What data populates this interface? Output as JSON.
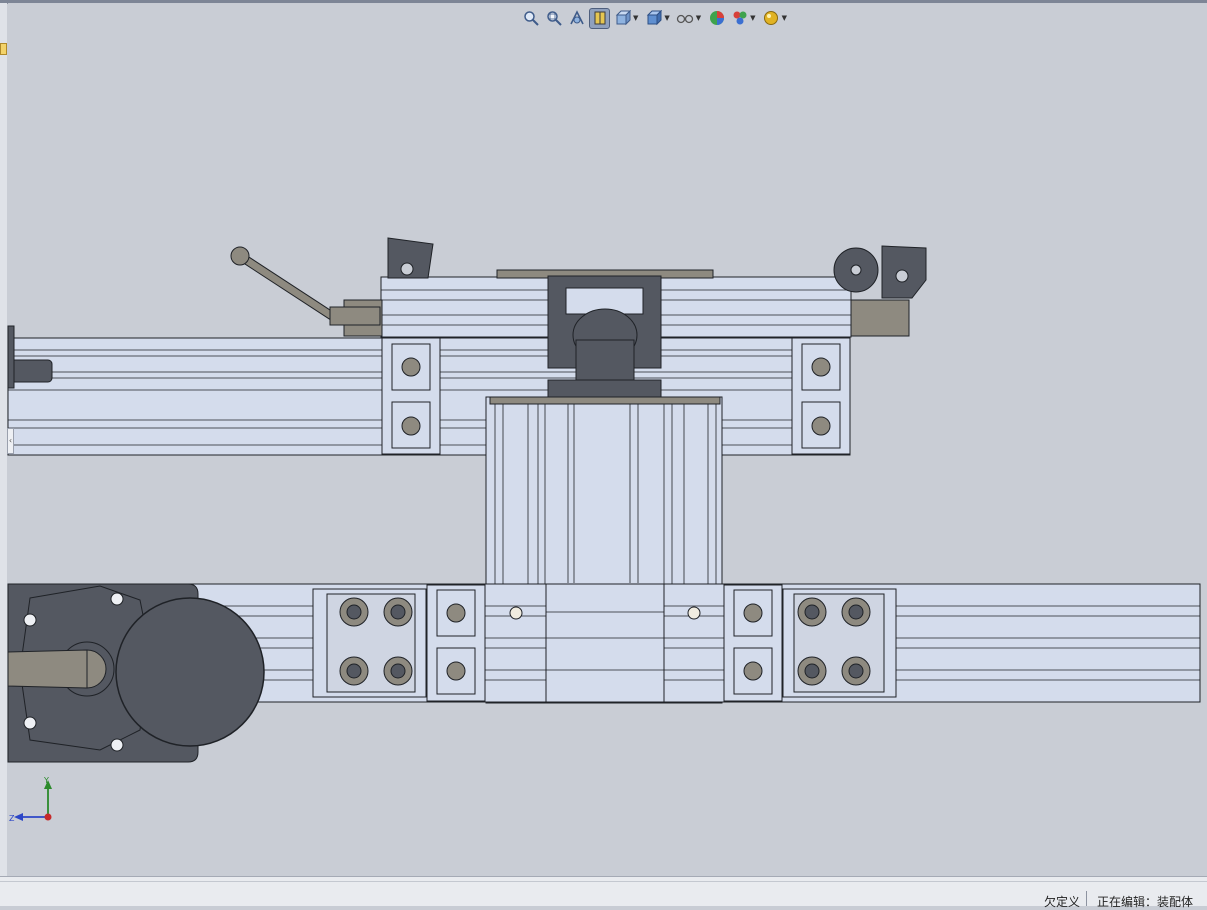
{
  "status_bar": {
    "constraint_status": "欠定义",
    "edit_mode": "正在编辑：装配体"
  },
  "triad": {
    "y_label": "Y",
    "z_label": "Z"
  },
  "heads_up_toolbar": {
    "tools": [
      {
        "name": "zoom-to-fit-icon"
      },
      {
        "name": "zoom-to-area-icon"
      },
      {
        "name": "previous-view-icon"
      },
      {
        "name": "section-view-icon",
        "active": true
      },
      {
        "name": "view-orientation-icon",
        "dropdown": true
      },
      {
        "name": "display-style-icon",
        "dropdown": true
      },
      {
        "name": "hide-show-items-icon",
        "dropdown": true
      },
      {
        "name": "edit-appearance-icon"
      },
      {
        "name": "apply-scene-icon",
        "dropdown": true
      },
      {
        "name": "view-settings-icon",
        "dropdown": true
      }
    ]
  },
  "colors": {
    "background": "#c9cdd5",
    "profile": "#d4dcec",
    "part_dark": "#545861",
    "part_medium": "#8e8a80",
    "edge": "#1f2227"
  }
}
